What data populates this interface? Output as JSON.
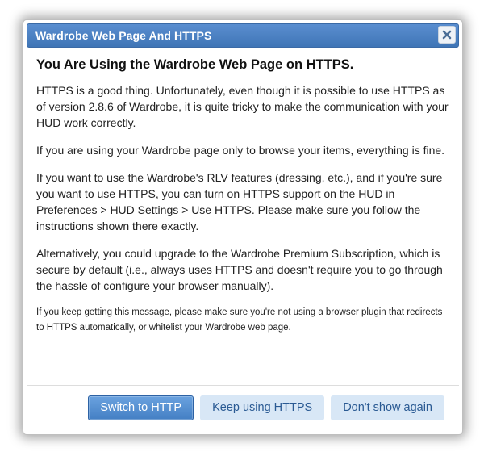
{
  "dialog": {
    "title": "Wardrobe Web Page And HTTPS",
    "close_icon": "close-icon"
  },
  "content": {
    "heading": "You Are Using the Wardrobe Web Page on HTTPS.",
    "paragraphs": [
      "HTTPS is a good thing. Unfortunately, even though it is possible to use HTTPS as of version 2.8.6 of Wardrobe, it is quite tricky to make the communication with your HUD work correctly.",
      "If you are using your Wardrobe page only to browse your items, everything is fine.",
      "If you want to use the Wardrobe's RLV features (dressing, etc.), and if you're sure you want to use HTTPS, you can turn on HTTPS support on the HUD in Preferences > HUD Settings > Use HTTPS. Please make sure you follow the instructions shown there exactly.",
      "Alternatively, you could upgrade to the Wardrobe Premium Subscription, which is secure by default (i.e., always uses HTTPS and doesn't require you to go through the hassle of configure your browser manually)."
    ],
    "note": "If you keep getting this message, please make sure you're not using a browser plugin that redirects to HTTPS automatically, or whitelist your Wardrobe web page."
  },
  "buttons": {
    "switch_http": "Switch to HTTP",
    "keep_https": "Keep using HTTPS",
    "dont_show": "Don't show again"
  },
  "colors": {
    "titlebar": "#4a7fbf",
    "primary_button": "#4f8cd2",
    "secondary_button": "#d8e7f6"
  }
}
